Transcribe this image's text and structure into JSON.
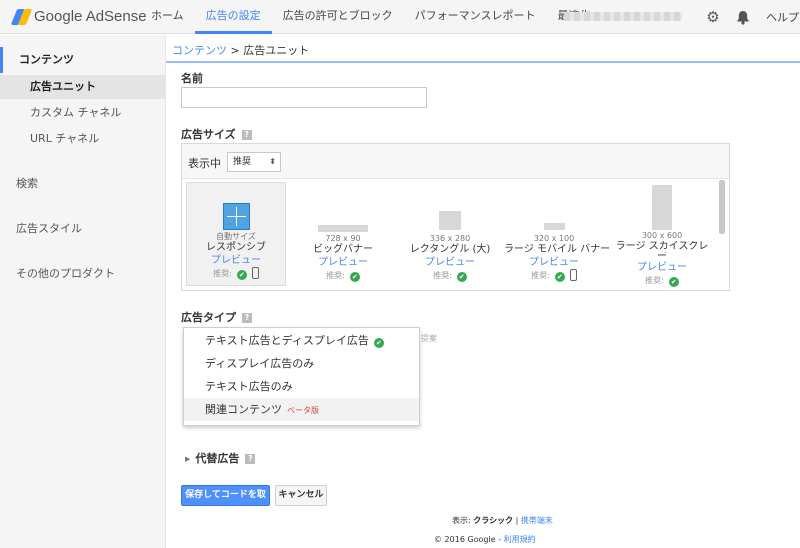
{
  "header": {
    "brand": "Google AdSense",
    "nav": [
      {
        "label": "ホーム"
      },
      {
        "label": "広告の設定"
      },
      {
        "label": "広告の許可とブロック"
      },
      {
        "label": "パフォーマンスレポート"
      },
      {
        "label": "最適化"
      }
    ],
    "active_nav": "広告の設定",
    "settings_icon": "gear-icon",
    "notifications_icon": "bell-icon",
    "help_label": "ヘルプ"
  },
  "sidebar": {
    "content_label": "コンテンツ",
    "sub_items": [
      {
        "label": "広告ユニット",
        "selected": true
      },
      {
        "label": "カスタム チャネル"
      },
      {
        "label": "URL チャネル"
      }
    ],
    "search_label": "検索",
    "ad_style_label": "広告スタイル",
    "other_products_label": "その他のプロダクト"
  },
  "breadcrumb": {
    "parent": "コンテンツ",
    "separator": ">",
    "current": "広告ユニット"
  },
  "form": {
    "name_label": "名前",
    "name_value": "",
    "ad_size_label": "広告サイズ",
    "help_glyph": "?",
    "show_label": "表示中",
    "show_select_value": "推奨",
    "sizes": [
      {
        "dim": "自動サイズ",
        "name": "レスポンシブ",
        "preview": "プレビュー",
        "rec": "推奨:",
        "selected": true
      },
      {
        "dim": "728 x 90",
        "name": "ビッグバナー",
        "preview": "プレビュー",
        "rec": "推奨:"
      },
      {
        "dim": "336 x 280",
        "name": "レクタングル (大)",
        "preview": "プレビュー",
        "rec": "推奨:"
      },
      {
        "dim": "320 x 100",
        "name": "ラージ モバイル バナー",
        "preview": "プレビュー",
        "rec": "推奨:"
      },
      {
        "dim": "300 x 600",
        "name": "ラージ スカイスクレイパー",
        "preview": "プレビュー",
        "rec": "推奨:"
      }
    ],
    "ad_type_label": "広告タイプ",
    "ad_type_fragment": "提案",
    "ad_type_options": [
      {
        "label": "テキスト広告とディスプレイ広告",
        "selected": true
      },
      {
        "label": "ディスプレイ広告のみ"
      },
      {
        "label": "テキスト広告のみ"
      },
      {
        "label": "関連コンテンツ",
        "badge": "ベータ版"
      }
    ],
    "alt_ads_label": "代替広告",
    "save_button": "保存してコードを取得",
    "cancel_button": "キャンセル"
  },
  "footer": {
    "view_label": "表示:",
    "classic_label": "クラシック",
    "separator": "|",
    "mobile_link": "携帯端末",
    "copyright": "© 2016 Google -",
    "terms_link": "利用規約"
  },
  "colors": {
    "accent": "#4285f4",
    "check": "#34a853",
    "beta": "#d14836"
  }
}
